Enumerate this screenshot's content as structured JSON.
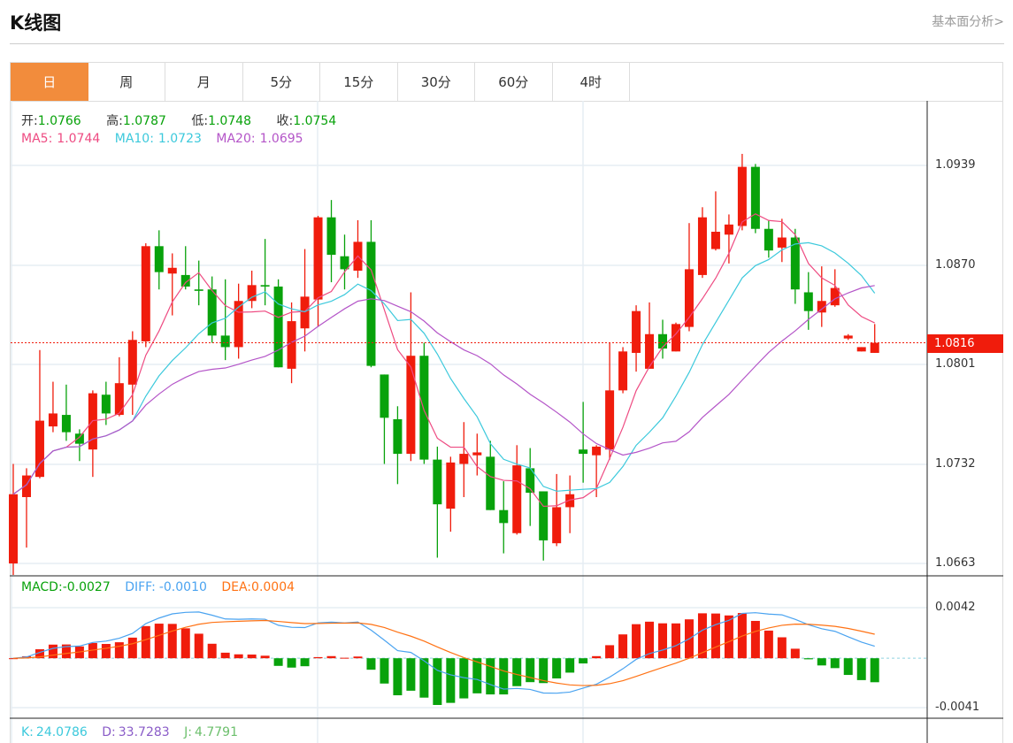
{
  "header": {
    "title": "K线图",
    "link": "基本面分析>"
  },
  "tabs": [
    {
      "label": "日",
      "active": true
    },
    {
      "label": "周"
    },
    {
      "label": "月"
    },
    {
      "label": "5分"
    },
    {
      "label": "15分"
    },
    {
      "label": "30分"
    },
    {
      "label": "60分"
    },
    {
      "label": "4时"
    }
  ],
  "info": {
    "open_label": "开:",
    "open": "1.0766",
    "high_label": "高:",
    "high": "1.0787",
    "low_label": "低:",
    "low": "1.0748",
    "close_label": "收:",
    "close": "1.0754",
    "ma5_label": "MA5:",
    "ma5": "1.0744",
    "ma10_label": "MA10:",
    "ma10": "1.0723",
    "ma20_label": "MA20:",
    "ma20": "1.0695"
  },
  "macd_info": {
    "macd_label": "MACD:",
    "macd": "-0.0027",
    "diff_label": "DIFF:",
    "diff": "-0.0010",
    "dea_label": "DEA:",
    "dea": "0.0004"
  },
  "kdj_info": {
    "k_label": "K:",
    "k": "24.0786",
    "d_label": "D:",
    "d": "33.7283",
    "j_label": "J:",
    "j": "4.7791"
  },
  "colors": {
    "up": "#f01c0c",
    "down": "#08a20b",
    "ma5": "#ee4b82",
    "ma10": "#3cc9dc",
    "ma20": "#b455c8",
    "diff": "#4aa3f0",
    "dea": "#ff7214",
    "accent": "#f28c3c"
  },
  "chart_data": {
    "type": "candlestick",
    "price_axis": {
      "ticks": [
        "1.0939",
        "1.0870",
        "1.0801",
        "1.0732",
        "1.0663"
      ],
      "ylim": [
        1.0663,
        1.0939
      ]
    },
    "current_price": "1.0816",
    "macd_axis": {
      "ticks": [
        "0.0042",
        "-0.0041"
      ],
      "ylim": [
        -0.0041,
        0.0042
      ]
    },
    "ohlc": [
      [
        1.0663,
        1.0732,
        1.0655,
        1.0711
      ],
      [
        1.0709,
        1.0729,
        1.0674,
        1.0724
      ],
      [
        1.0723,
        1.0811,
        1.0722,
        1.0762
      ],
      [
        1.0758,
        1.0789,
        1.0754,
        1.0767
      ],
      [
        1.0766,
        1.0787,
        1.0748,
        1.0754
      ],
      [
        1.0753,
        1.0756,
        1.0734,
        1.0746
      ],
      [
        1.0742,
        1.0783,
        1.0723,
        1.0781
      ],
      [
        1.078,
        1.0789,
        1.0759,
        1.0767
      ],
      [
        1.0766,
        1.0806,
        1.0765,
        1.0788
      ],
      [
        1.0787,
        1.0824,
        1.0766,
        1.0818
      ],
      [
        1.0817,
        1.0885,
        1.0813,
        1.0883
      ],
      [
        1.0883,
        1.0894,
        1.0853,
        1.0865
      ],
      [
        1.0864,
        1.0878,
        1.0835,
        1.0868
      ],
      [
        1.0863,
        1.0883,
        1.0853,
        1.0855
      ],
      [
        1.0853,
        1.0873,
        1.0842,
        1.0852
      ],
      [
        1.0853,
        1.0862,
        1.0816,
        1.0821
      ],
      [
        1.0821,
        1.086,
        1.0804,
        1.0813
      ],
      [
        1.0813,
        1.0857,
        1.0805,
        1.0845
      ],
      [
        1.0845,
        1.0866,
        1.084,
        1.0856
      ],
      [
        1.0856,
        1.0888,
        1.0842,
        1.0855
      ],
      [
        1.0855,
        1.086,
        1.0799,
        1.0799
      ],
      [
        1.0798,
        1.0844,
        1.0788,
        1.0831
      ],
      [
        1.0826,
        1.0881,
        1.081,
        1.0848
      ],
      [
        1.0846,
        1.0904,
        1.0827,
        1.0903
      ],
      [
        1.0903,
        1.0915,
        1.0858,
        1.0877
      ],
      [
        1.0876,
        1.0891,
        1.0853,
        1.0867
      ],
      [
        1.0866,
        1.0901,
        1.0861,
        1.0886
      ],
      [
        1.0886,
        1.0901,
        1.0799,
        1.08
      ],
      [
        1.0794,
        1.0794,
        1.0732,
        1.0764
      ],
      [
        1.0763,
        1.0772,
        1.0718,
        1.0739
      ],
      [
        1.0739,
        1.0851,
        1.0734,
        1.0807
      ],
      [
        1.0807,
        1.0816,
        1.0732,
        1.0735
      ],
      [
        1.0735,
        1.0744,
        1.0667,
        1.0704
      ],
      [
        1.0701,
        1.0737,
        1.0685,
        1.0733
      ],
      [
        1.0732,
        1.0761,
        1.0709,
        1.0739
      ],
      [
        1.0738,
        1.0753,
        1.0724,
        1.074
      ],
      [
        1.0737,
        1.0748,
        1.07,
        1.07
      ],
      [
        1.07,
        1.072,
        1.067,
        1.0691
      ],
      [
        1.0684,
        1.0745,
        1.0683,
        1.0731
      ],
      [
        1.0729,
        1.0743,
        1.0689,
        1.0712
      ],
      [
        1.0713,
        1.0713,
        1.0665,
        1.0679
      ],
      [
        1.0677,
        1.0725,
        1.0675,
        1.0702
      ],
      [
        1.0702,
        1.0724,
        1.0684,
        1.0711
      ],
      [
        1.0742,
        1.0775,
        1.0719,
        1.0739
      ],
      [
        1.0738,
        1.0745,
        1.0709,
        1.0744
      ],
      [
        1.0742,
        1.0816,
        1.0735,
        1.0783
      ],
      [
        1.0783,
        1.0813,
        1.0781,
        1.081
      ],
      [
        1.0809,
        1.0842,
        1.0796,
        1.0838
      ],
      [
        1.0798,
        1.0844,
        1.0798,
        1.0822
      ],
      [
        1.0822,
        1.0832,
        1.0805,
        1.0812
      ],
      [
        1.081,
        1.083,
        1.081,
        1.0829
      ],
      [
        1.0827,
        1.0899,
        1.0824,
        1.0867
      ],
      [
        1.0863,
        1.091,
        1.0861,
        1.0903
      ],
      [
        1.0881,
        1.0921,
        1.088,
        1.0893
      ],
      [
        1.0891,
        1.0905,
        1.0871,
        1.0898
      ],
      [
        1.0897,
        1.0947,
        1.0894,
        1.0938
      ],
      [
        1.0938,
        1.094,
        1.0892,
        1.0895
      ],
      [
        1.0895,
        1.0901,
        1.0875,
        1.088
      ],
      [
        1.0882,
        1.0902,
        1.0872,
        1.0889
      ],
      [
        1.0889,
        1.0895,
        1.0843,
        1.0853
      ],
      [
        1.0851,
        1.0865,
        1.0825,
        1.0838
      ],
      [
        1.0837,
        1.0869,
        1.0827,
        1.0845
      ],
      [
        1.0842,
        1.0867,
        1.0841,
        1.0854
      ],
      [
        1.0819,
        1.0822,
        1.0818,
        1.0821
      ],
      [
        1.081,
        1.0813,
        1.081,
        1.0813
      ],
      [
        1.0809,
        1.0829,
        1.0809,
        1.0816
      ]
    ]
  }
}
